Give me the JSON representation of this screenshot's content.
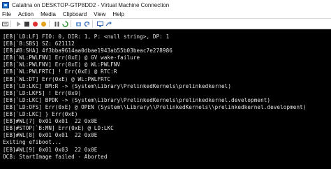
{
  "window": {
    "title": "Catalina on DESKTOP-GTP8DD2 - Virtual Machine Connection"
  },
  "menu": {
    "items": [
      "File",
      "Action",
      "Media",
      "Clipboard",
      "View",
      "Help"
    ]
  },
  "toolbar": {
    "icons": [
      "ctrl-alt-del-icon",
      "start-icon",
      "turn-off-icon",
      "shutdown-icon",
      "save-icon",
      "pause-icon",
      "reset-icon",
      "checkpoint-icon",
      "revert-icon",
      "enhanced-session-icon",
      "share-icon"
    ]
  },
  "console": {
    "lines": [
      "[EB|`LD:LF] FIO: 0, DIR: 1, P: <null string>, DP: 1",
      "[EB|`B:SBS] SZ: 621112",
      "[EB|#B:SHA] 4f3bba9614aa0dbae1943ab55b03beac7e278986",
      "[EB|`WL:PWLFNV] Err(0xE) @ GV wake-failure",
      "[EB|`WL:PWLFNV] Err(0xE) @ WL:PWLFNV",
      "[EB|`WL:PWLFRTC] ! Err(0xE) @ RTC:R",
      "[EB|`WL:DT] Err(0xE) @ WL:PWLFRTC",
      "[EB|`LD:LKC] BM:R -> (System\\Library\\PrelinkedKernels\\prelinkedkernel)",
      "[EB|`LD:LKFS] ! Err(0x9)",
      "[EB|`LD:LKC] BPDK -> (System\\Library\\PrelinkedKernels\\prelinkedkernel.development)",
      "[EB|`LD:OFS] Err(0xE) @ OPEN (System\\\\Library\\\\PrelinkedKernels\\\\prelinkedkernel.development)",
      "[EB|`LD:LKC] } Err(0xE)",
      "[EB]#WL[7] 0x01 0x01  22 0x0E",
      "[EB|#STOP|`B:MN] Err(0xE) @ LD:LKC",
      "[EB]#WL[8] 0x01 0x01  22 0x0E",
      "Exiting efiboot...",
      "[EB]#WL[9] 0x01 0x03  22 0x0E",
      "OCB: StartImage failed - Aborted"
    ]
  }
}
